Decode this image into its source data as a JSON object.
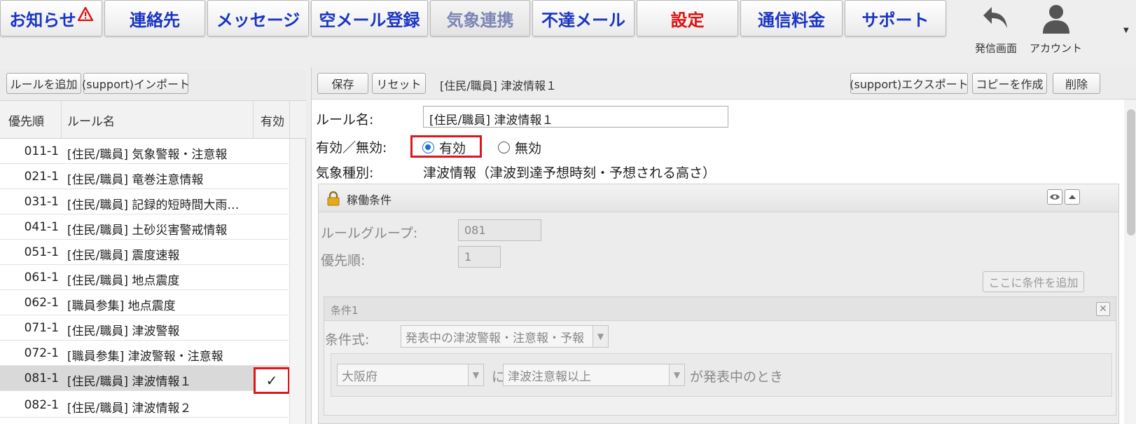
{
  "nav": {
    "items": [
      {
        "label": "お知らせ",
        "color": "#1a35c4"
      },
      {
        "label": "連絡先",
        "color": "#1a35c4"
      },
      {
        "label": "メッセージ",
        "color": "#1a35c4"
      },
      {
        "label": "空メール登録",
        "color": "#1a35c4"
      },
      {
        "label": "気象連携",
        "color": "#7d86b5"
      },
      {
        "label": "不達メール",
        "color": "#1a35c4"
      },
      {
        "label": "設定",
        "color": "#e0120f"
      },
      {
        "label": "通信料金",
        "color": "#1a35c4"
      },
      {
        "label": "サポート",
        "color": "#1a35c4"
      }
    ],
    "send_screen_label": "発信画面",
    "account_label": "アカウント"
  },
  "left": {
    "add_rule_label": "ルールを追加",
    "import_label": "(support)インポート",
    "columns": {
      "priority": "優先順",
      "name": "ルール名",
      "enabled": "有効"
    },
    "rows": [
      {
        "priority": "011-1",
        "name": "[住民/職員] 気象警報・注意報",
        "enabled": ""
      },
      {
        "priority": "021-1",
        "name": "[住民/職員] 竜巻注意情報",
        "enabled": ""
      },
      {
        "priority": "031-1",
        "name": "[住民/職員] 記録的短時間大雨…",
        "enabled": ""
      },
      {
        "priority": "041-1",
        "name": "[住民/職員] 土砂災害警戒情報",
        "enabled": ""
      },
      {
        "priority": "051-1",
        "name": "[住民/職員] 震度速報",
        "enabled": ""
      },
      {
        "priority": "061-1",
        "name": "[住民/職員] 地点震度",
        "enabled": ""
      },
      {
        "priority": "062-1",
        "name": "[職員参集] 地点震度",
        "enabled": ""
      },
      {
        "priority": "071-1",
        "name": "[住民/職員] 津波警報",
        "enabled": ""
      },
      {
        "priority": "072-1",
        "name": "[職員参集] 津波警報・注意報",
        "enabled": ""
      },
      {
        "priority": "081-1",
        "name": "[住民/職員] 津波情報１",
        "enabled": "✓"
      },
      {
        "priority": "082-1",
        "name": "[住民/職員] 津波情報２",
        "enabled": ""
      }
    ]
  },
  "right": {
    "save_label": "保存",
    "reset_label": "リセット",
    "title": "[住民/職員] 津波情報１",
    "export_label": "(support)エクスポート",
    "copy_label": "コピーを作成",
    "delete_label": "削除",
    "rule_name_label": "ルール名:",
    "rule_name_value": "[住民/職員] 津波情報１",
    "status_label": "有効／無効:",
    "status_on_label": "有効",
    "status_off_label": "無効",
    "weather_type_label": "気象種別:",
    "weather_type_value": "津波情報（津波到達予想時刻・予想される高さ）",
    "panel": {
      "title": "稼働条件",
      "group_label": "ルールグループ:",
      "group_value": "081",
      "priority_label": "優先順:",
      "priority_value": "1",
      "add_condition_label": "ここに条件を追加",
      "condition": {
        "title": "条件1",
        "expr_label": "条件式:",
        "expr_value": "発表中の津波警報・注意報・予報",
        "pref_value": "大阪府",
        "ni_text": "に",
        "level_value": "津波注意報以上",
        "suffix_text": "が発表中のとき"
      }
    }
  }
}
